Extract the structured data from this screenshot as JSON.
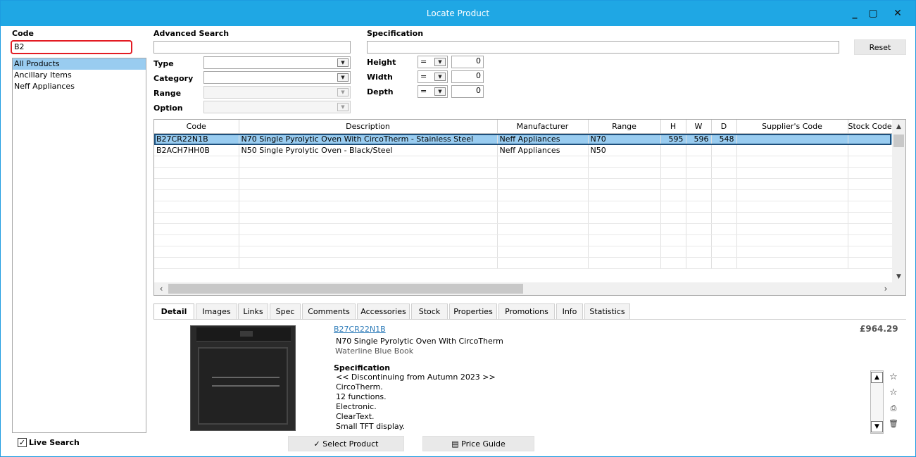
{
  "window": {
    "title": "Locate Product",
    "controls": [
      "_",
      "▢",
      "✕"
    ]
  },
  "code": {
    "label": "Code",
    "value": "B2"
  },
  "categories": [
    {
      "label": "All Products",
      "selected": true
    },
    {
      "label": "Ancillary Items",
      "selected": false
    },
    {
      "label": "Neff Appliances",
      "selected": false
    }
  ],
  "advanced_search": {
    "header": "Advanced Search",
    "search_value": "",
    "fields": [
      {
        "label": "Type",
        "value": "",
        "enabled": true
      },
      {
        "label": "Category",
        "value": "",
        "enabled": true
      },
      {
        "label": "Range",
        "value": "",
        "enabled": false
      },
      {
        "label": "Option",
        "value": "",
        "enabled": false
      }
    ]
  },
  "specification": {
    "header": "Specification",
    "search_value": "",
    "dims": [
      {
        "label": "Height",
        "op": "=",
        "value": "0"
      },
      {
        "label": "Width",
        "op": "=",
        "value": "0"
      },
      {
        "label": "Depth",
        "op": "=",
        "value": "0"
      }
    ],
    "reset_label": "Reset"
  },
  "grid": {
    "columns": [
      "Code",
      "Description",
      "Manufacturer",
      "Range",
      "H",
      "W",
      "D",
      "Supplier's Code",
      "Stock Code"
    ],
    "rows": [
      {
        "code": "B27CR22N1B",
        "description": "N70 Single Pyrolytic Oven With CircoTherm - Stainless Steel",
        "manufacturer": "Neff Appliances",
        "range": "N70",
        "h": "595",
        "w": "596",
        "d": "548",
        "supplier": "",
        "stock": "",
        "selected": true
      },
      {
        "code": "B2ACH7HH0B",
        "description": "N50 Single Pyrolytic Oven - Black/Steel",
        "manufacturer": "Neff Appliances",
        "range": "N50",
        "h": "",
        "w": "",
        "d": "",
        "supplier": "",
        "stock": "",
        "selected": false
      }
    ],
    "empty_rows": 10
  },
  "tabs": [
    {
      "label": "Detail",
      "active": true
    },
    {
      "label": "Images"
    },
    {
      "label": "Links"
    },
    {
      "label": "Spec"
    },
    {
      "label": "Comments"
    },
    {
      "label": "Accessories"
    },
    {
      "label": "Stock"
    },
    {
      "label": "Properties"
    },
    {
      "label": "Promotions"
    },
    {
      "label": "Info"
    },
    {
      "label": "Statistics"
    }
  ],
  "detail": {
    "code_link": "B27CR22N1B",
    "price": "£964.29",
    "name": "N70 Single Pyrolytic Oven With CircoTherm",
    "book": "Waterline Blue Book",
    "spec_header": "Specification",
    "spec_lines": [
      "<< Discontinuing from Autumn 2023 >>",
      "CircoTherm.",
      "12 functions.",
      "Electronic.",
      "ClearText.",
      "Small TFT display."
    ]
  },
  "side_icons": [
    "star-outline-icon",
    "star-outline-icon",
    "print-icon",
    "delete-icon"
  ],
  "footer": {
    "live_search_label": "Live Search",
    "live_search_checked": true,
    "select_product_label": "Select Product",
    "price_guide_label": "Price Guide"
  }
}
